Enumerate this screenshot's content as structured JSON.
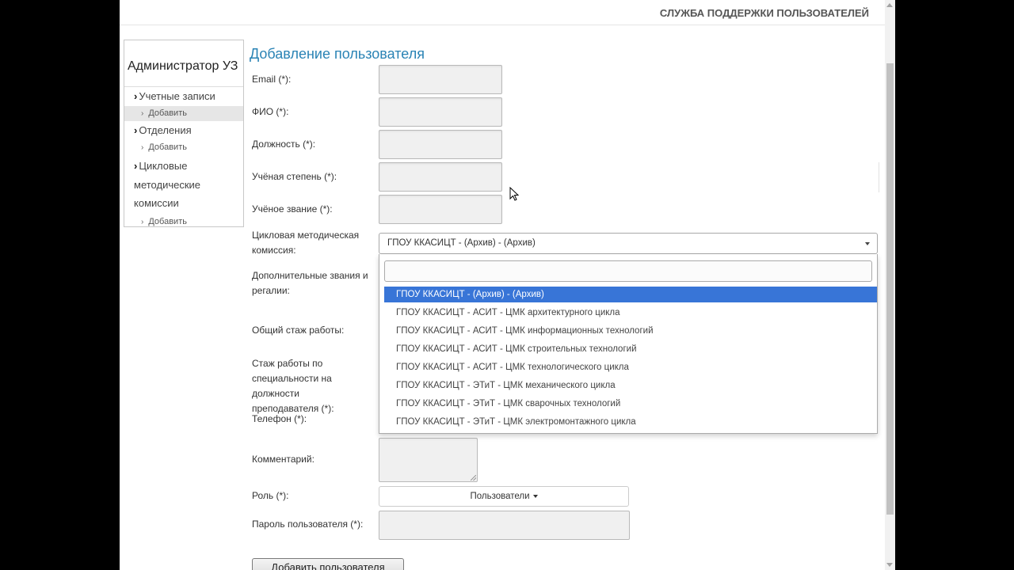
{
  "header": {
    "title": "СЛУЖБА ПОДДЕРЖКИ ПОЛЬЗОВАТЕЛЕЙ"
  },
  "sidebar": {
    "brand": "Администратор УЗ",
    "sections": [
      {
        "label": "Учетные записи",
        "sub_label": "Добавить"
      },
      {
        "label": "Отделения",
        "sub_label": "Добавить"
      },
      {
        "label_lines": [
          "Цикловые",
          "методические",
          "комиссии"
        ],
        "sub_label": "Добавить"
      }
    ]
  },
  "form": {
    "title": "Добавление пользователя",
    "labels": {
      "email": "Email (*):",
      "fio": "ФИО (*):",
      "position": "Должность (*):",
      "degree": "Учёная степень (*):",
      "rank": "Учёное звание (*):",
      "commission": [
        "Цикловая методическая",
        "комиссия:"
      ],
      "extra_titles": [
        "Дополнительные звания и",
        "регалии:"
      ],
      "total_experience": "Общий стаж работы:",
      "teaching_experience": [
        "Стаж работы по",
        "специальности на должности",
        "преподавателя (*):"
      ],
      "phone": "Телефон (*):",
      "comment": "Комментарий:",
      "role": "Роль (*):",
      "password": "Пароль пользователя (*):"
    },
    "commission_select": {
      "value": "ГПОУ ККАСИЦТ - (Архив) - (Архив)",
      "options": [
        "ГПОУ ККАСИЦТ - (Архив) - (Архив)",
        "ГПОУ ККАСИЦТ - АСИТ - ЦМК архитектурного цикла",
        "ГПОУ ККАСИЦТ - АСИТ - ЦМК информационных технологий",
        "ГПОУ ККАСИЦТ - АСИТ - ЦМК строительных технологий",
        "ГПОУ ККАСИЦТ - АСИТ - ЦМК технологического цикла",
        "ГПОУ ККАСИЦТ - ЭТиТ - ЦМК механического цикла",
        "ГПОУ ККАСИЦТ - ЭТиТ - ЦМК сварочных технологий",
        "ГПОУ ККАСИЦТ - ЭТиТ - ЦМК электромонтажного цикла"
      ],
      "selected_index": 0
    },
    "role_value": "Пользователи",
    "submit_label": "Добавить пользователя"
  },
  "colors": {
    "title_blue": "#2a83b5",
    "option_highlight": "#3875d7"
  }
}
